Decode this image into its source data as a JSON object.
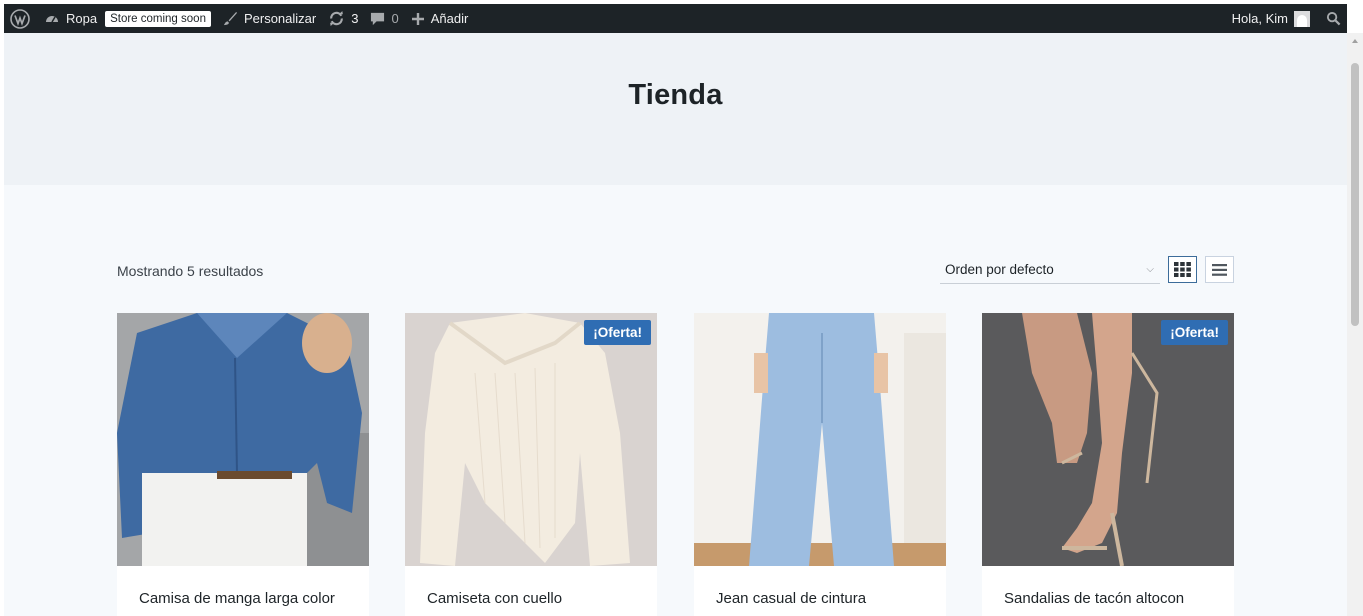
{
  "adminbar": {
    "site_name": "Ropa",
    "store_badge": "Store coming soon",
    "customize_label": "Personalizar",
    "updates_count": "3",
    "comments_count": "0",
    "new_label": "Añadir",
    "greeting": "Hola, Kim"
  },
  "page": {
    "title": "Tienda",
    "results_text": "Mostrando 5 resultados",
    "orderby_selected": "Orden por defecto"
  },
  "products": [
    {
      "title": "Camisa de manga larga color",
      "sale": false
    },
    {
      "title": "Camiseta con cuello",
      "sale": true,
      "sale_label": "¡Oferta!"
    },
    {
      "title": "Jean casual de cintura",
      "sale": false
    },
    {
      "title": "Sandalias de tacón altocon",
      "sale": true,
      "sale_label": "¡Oferta!"
    }
  ],
  "colors": {
    "adminbar_bg": "#1d2327",
    "sale_badge": "#2f6db3",
    "hero_bg": "#eef2f6"
  },
  "icons": [
    "wordpress-icon",
    "dashboard-icon",
    "brush-icon",
    "updates-icon",
    "comment-icon",
    "plus-icon",
    "search-icon",
    "grid-view-icon",
    "list-view-icon",
    "chevron-down-icon"
  ]
}
